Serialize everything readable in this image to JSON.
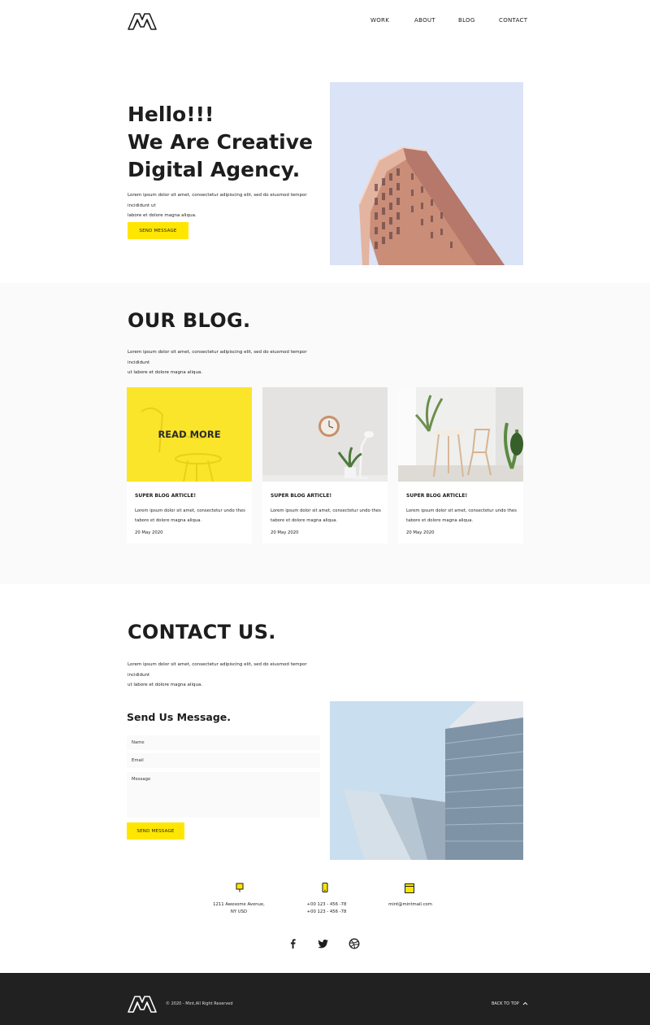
{
  "header": {
    "nav": [
      "WORK",
      "ABOUT",
      "BLOG",
      "CONTACT"
    ]
  },
  "hero": {
    "title_line1": "Hello!!!",
    "title_line2": "We Are Creative",
    "title_line3": "Digital Agency.",
    "description_line1": "Lorem ipsum dolor sit amet, consectetur adipiscing elit, sed do eiusmod tempor incididunt ut",
    "description_line2": "labore et dolore magna aliqua.",
    "button_label": "SEND MESSAGE"
  },
  "blog": {
    "title": "OUR BLOG.",
    "description_line1": "Lorem ipsum dolor sit amet, consectetur adipiscing elit, sed do eiusmod tempor incididunt",
    "description_line2": "ut labore et dolore magna aliqua.",
    "read_more": "READ MORE",
    "cards": [
      {
        "title": "SUPER BLOG ARTICLE!",
        "text_line1": "Lorem ipsum dolor sit amet, consectetur undo thes",
        "text_line2": "tabore et dolore magna aliqua.",
        "date": "20 May 2020"
      },
      {
        "title": "SUPER BLOG ARTICLE!",
        "text_line1": "Lorem ipsum dolor sit amet, consectetur undo thes",
        "text_line2": "tabore et dolore magna aliqua.",
        "date": "20 May 2020"
      },
      {
        "title": "SUPER BLOG ARTICLE!",
        "text_line1": "Lorem ipsum dolor sit amet, consectetur undo thes",
        "text_line2": "tabore et dolore magna aliqua.",
        "date": "20 May 2020"
      }
    ]
  },
  "contact": {
    "title": "CONTACT US.",
    "description_line1": "Lorem ipsum dolor sit amet, consectetur adipiscing elit, sed do eiusmod tempor incididunt",
    "description_line2": "ut labore et dolore magna aliqua.",
    "form_title": "Send Us Message.",
    "name_placeholder": "Name",
    "email_placeholder": "Email",
    "message_placeholder": "Message",
    "button_label": "SEND MESSAGE",
    "address_line1": "1211 Awesome Avenue,",
    "address_line2": "NY USD",
    "phone_line1": "+00 123 - 456 -78",
    "phone_line2": "+00 123 - 456 -78",
    "email": "mint@mintmail.com"
  },
  "social_icons": [
    "facebook-icon",
    "twitter-icon",
    "dribbble-icon"
  ],
  "footer": {
    "copyright": "© 2020 - Mint,All Right Reserved",
    "back_to_top": "BACK TO TOP"
  },
  "colors": {
    "accent": "#ffe600",
    "dark": "#1d1d1d",
    "footer_bg": "#212121",
    "section_bg": "#fafafa"
  }
}
